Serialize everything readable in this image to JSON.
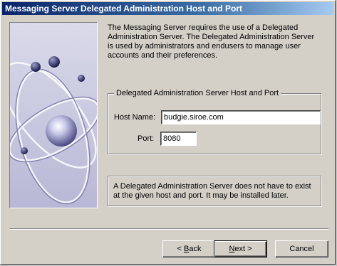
{
  "window": {
    "title": "Messaging Server Delegated Administration Host and Port"
  },
  "description": "The Messaging Server requires the use of a Delegated Administration Server. The Delegated Administration Server is used by administrators and endusers to manage user accounts and their preferences.",
  "group": {
    "legend": "Delegated Administration Server Host and Port",
    "host_label": "Host Name:",
    "host_value": "budgie.siroe.com",
    "port_label": "Port:",
    "port_value": "8080"
  },
  "note": "A Delegated Administration Server does not have to exist at the given host and port. It may be installed later.",
  "buttons": {
    "back": {
      "prefix": "< ",
      "mnemonic": "B",
      "rest": "ack"
    },
    "next": {
      "mnemonic": "N",
      "rest": "ext >"
    },
    "cancel": "Cancel"
  },
  "colors": {
    "titlebar_start": "#0a246a",
    "titlebar_end": "#a6caf0",
    "dialog_face": "#d4d0c8"
  }
}
